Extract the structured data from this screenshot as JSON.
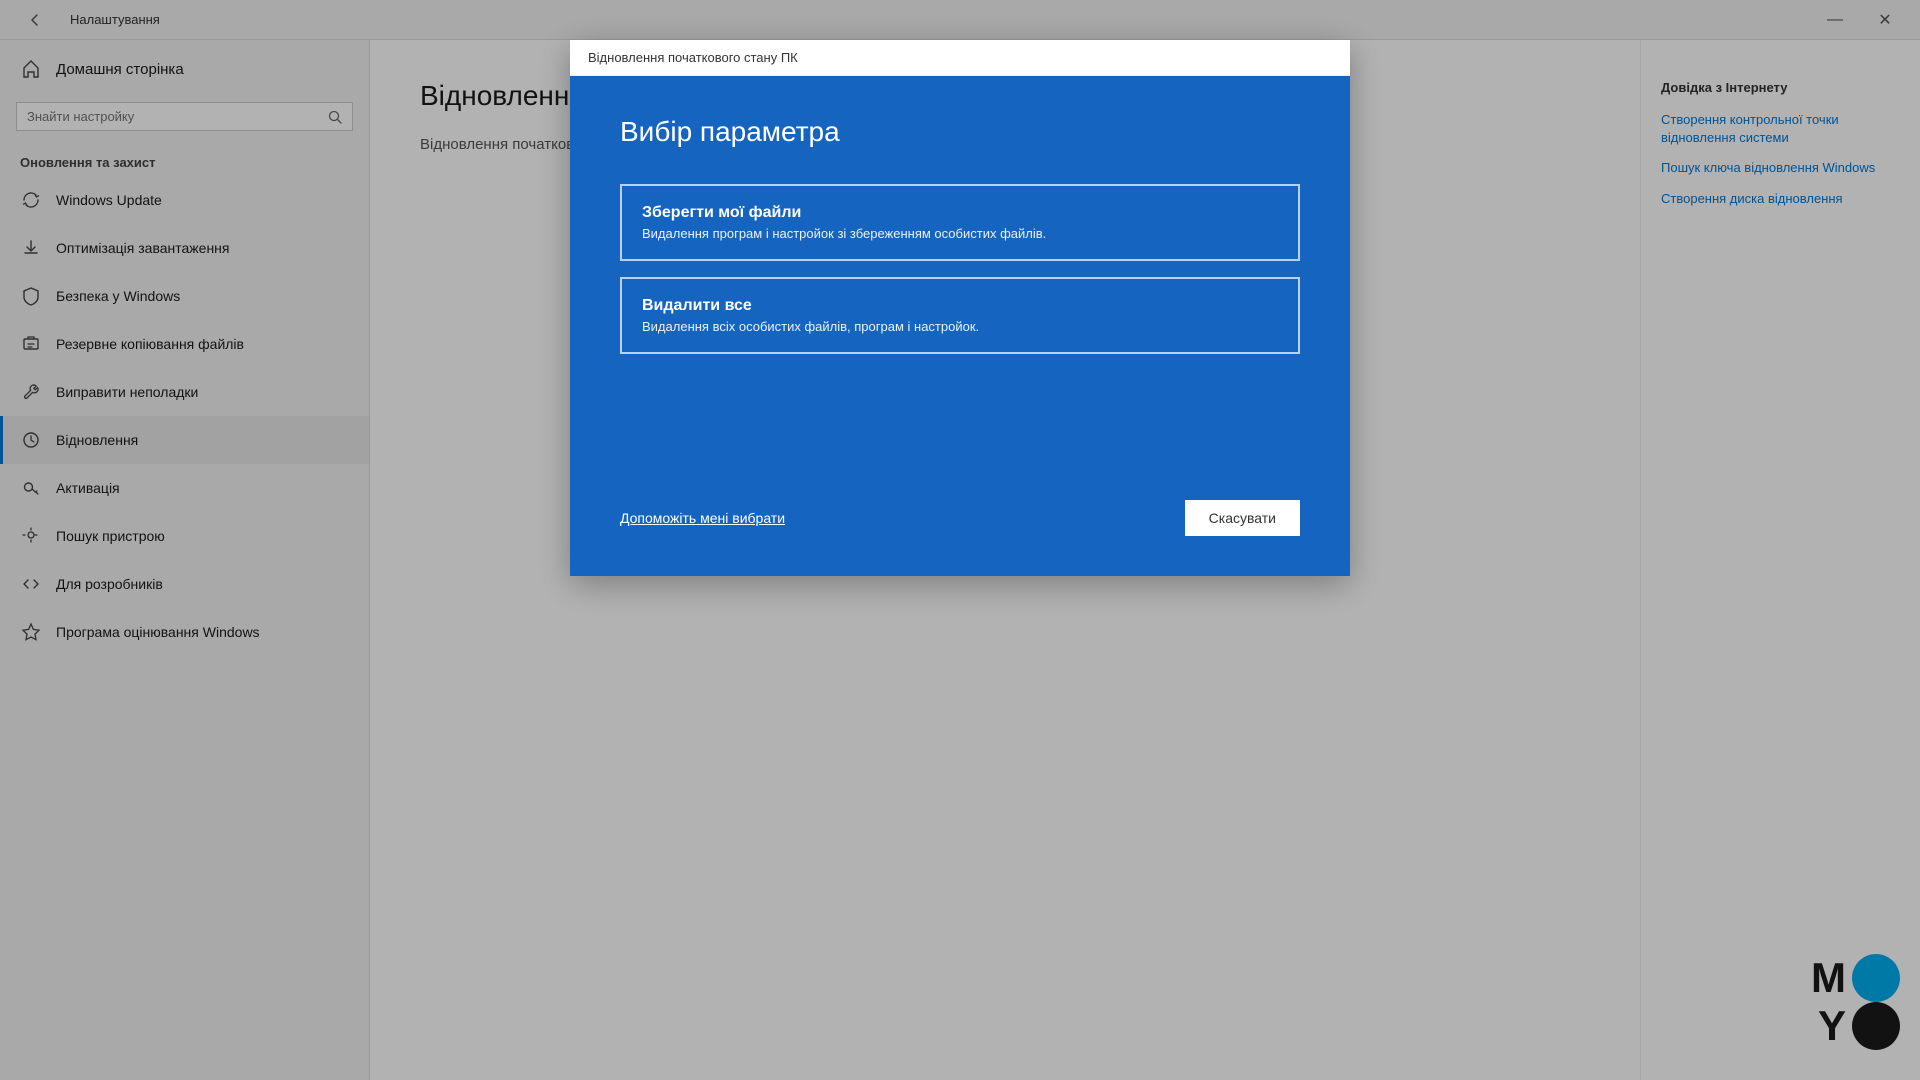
{
  "titlebar": {
    "title": "Налаштування",
    "minimize_label": "—",
    "close_label": "✕"
  },
  "sidebar": {
    "home_label": "Домашня сторінка",
    "search_placeholder": "Знайти настройку",
    "section_title": "Оновлення та захист",
    "items": [
      {
        "id": "windows-update",
        "label": "Windows Update",
        "icon": "refresh"
      },
      {
        "id": "delivery-optimization",
        "label": "Оптимізація завантаження",
        "icon": "download"
      },
      {
        "id": "windows-security",
        "label": "Безпека у Windows",
        "icon": "shield"
      },
      {
        "id": "backup",
        "label": "Резервне копіювання файлів",
        "icon": "backup"
      },
      {
        "id": "troubleshoot",
        "label": "Виправити неполадки",
        "icon": "wrench"
      },
      {
        "id": "recovery",
        "label": "Відновлення",
        "icon": "restore",
        "active": true
      },
      {
        "id": "activation",
        "label": "Активація",
        "icon": "key"
      },
      {
        "id": "find-device",
        "label": "Пошук пристрою",
        "icon": "locate"
      },
      {
        "id": "for-developers",
        "label": "Для розробників",
        "icon": "code"
      },
      {
        "id": "windows-insider",
        "label": "Програма оцінювання Windows",
        "icon": "star"
      }
    ]
  },
  "content": {
    "page_title": "Відновлення",
    "subtitle": "Відновлення початкового стану ПК"
  },
  "right_sidebar": {
    "title": "Довідка з Інтернету",
    "links": [
      {
        "label": "Створення контрольної точки відновлення системи"
      },
      {
        "label": "Пошук ключа відновлення Windows"
      },
      {
        "label": "Створення диска відновлення"
      }
    ]
  },
  "dialog": {
    "titlebar": "Відновлення початкового стану ПК",
    "heading": "Вибір параметра",
    "options": [
      {
        "title": "Зберегти мої файли",
        "description": "Видалення програм і настройок зі збереженням особистих файлів."
      },
      {
        "title": "Видалити все",
        "description": "Видалення всіх особистих файлів, програм і настройок."
      }
    ],
    "help_link": "Допоможіть мені вибрати",
    "cancel_button": "Скасувати"
  },
  "moyo": {
    "M": "M",
    "O_top": "O",
    "Y": "Y",
    "O_bottom": "O"
  }
}
